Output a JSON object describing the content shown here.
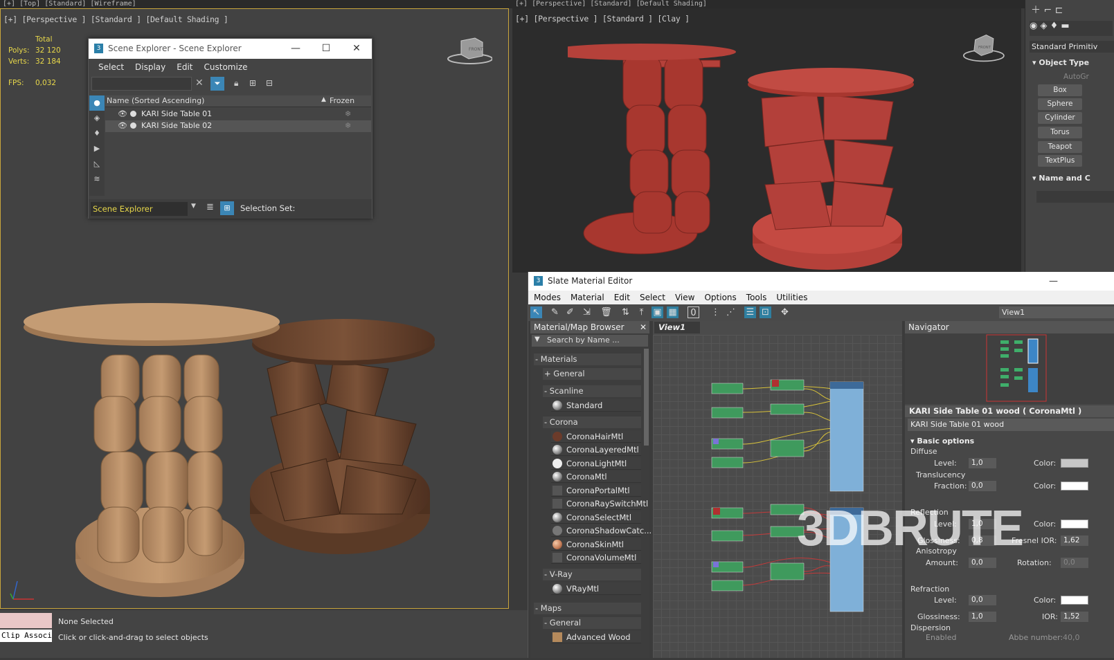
{
  "top_strip": {
    "left_text": "[+] [Top] [Standard] [Wireframe]",
    "right_text": "[+] [Perspective] [Standard] [Default Shading]"
  },
  "viewport_left": {
    "label": "[+] [Perspective ] [Standard ] [Default Shading ]",
    "stats": {
      "total_label": "Total",
      "polys_label": "Polys:",
      "polys_value": "32 120",
      "verts_label": "Verts:",
      "verts_value": "32 184",
      "fps_label": "FPS:",
      "fps_value": "0,032"
    },
    "viewcube_label": "FRONT"
  },
  "viewport_right": {
    "label": "[+] [Perspective ] [Standard ] [Clay ]",
    "viewcube_label": "FRONT"
  },
  "command_panel": {
    "dropdown": "Standard Primitiv",
    "section_object_type": "Object Type",
    "autogrid": "AutoGr",
    "buttons": [
      "Box",
      "Sphere",
      "Cylinder",
      "Torus",
      "Teapot",
      "TextPlus"
    ],
    "section_name": "Name and C"
  },
  "scene_explorer": {
    "title": "Scene Explorer - Scene Explorer",
    "menu": [
      "Select",
      "Display",
      "Edit",
      "Customize"
    ],
    "columns": {
      "name": "Name (Sorted Ascending)",
      "frozen": "Frozen"
    },
    "rows": [
      {
        "name": "KARI Side Table 01"
      },
      {
        "name": "KARI Side Table 02"
      }
    ],
    "footer_dropdown": "Scene Explorer",
    "selection_set_label": "Selection Set:"
  },
  "slate": {
    "title": "Slate Material Editor",
    "menu": [
      "Modes",
      "Material",
      "Edit",
      "Select",
      "View",
      "Options",
      "Tools",
      "Utilities"
    ],
    "view_dropdown": "View1",
    "browser": {
      "header": "Material/Map Browser",
      "search_placeholder": "Search by Name ...",
      "materials_label": "- Materials",
      "general": "+ General",
      "scanline": "- Scanline",
      "standard": "Standard",
      "corona": "- Corona",
      "corona_items": [
        "CoronaHairMtl",
        "CoronaLayeredMtl",
        "CoronaLightMtl",
        "CoronaMtl",
        "CoronaPortalMtl",
        "CoronaRaySwitchMtl",
        "CoronaSelectMtl",
        "CoronaShadowCatc...",
        "CoronaSkinMtl",
        "CoronaVolumeMtl"
      ],
      "vray": "- V-Ray",
      "vray_item": "VRayMtl",
      "maps_label": "- Maps",
      "maps_general": "- General",
      "maps_first": "Advanced Wood"
    },
    "view_tab": "View1",
    "navigator": "Navigator",
    "props": {
      "header": "KARI Side Table 01 wood  ( CoronaMtl )",
      "name_field": "KARI Side Table 01 wood",
      "basic_options": "Basic options",
      "diffuse": "Diffuse",
      "level": "Level:",
      "diffuse_level": "1,0",
      "color": "Color:",
      "translucency": "Translucency",
      "fraction": "Fraction:",
      "fraction_value": "0,0",
      "reflection": "Reflection",
      "refl_level": "1,0",
      "glossiness": "Glossiness:",
      "refl_gloss": "0,8",
      "fresnel": "Fresnel IOR:",
      "fresnel_value": "1,62",
      "anisotropy": "Anisotropy",
      "amount": "Amount:",
      "amount_value": "0,0",
      "rotation": "Rotation:",
      "rotation_value": "0,0",
      "refraction": "Refraction",
      "refr_level": "0,0",
      "refr_gloss": "1,0",
      "ior": "IOR:",
      "ior_value": "1,52",
      "dispersion": "Dispersion",
      "enabled": "Enabled",
      "abbe": "Abbe number:",
      "abbe_value": "40,0"
    },
    "watermark": "3DBRUTE"
  },
  "status": {
    "clip_label": "Clip Associ",
    "none_selected": "None Selected",
    "hint": "Click or click-and-drag to select objects"
  },
  "colors": {
    "viewport_border": "#c9a53c",
    "stat_yellow": "#e8d84a",
    "clay_red": "#b5413a",
    "wood_light": "#b08560",
    "wood_dark": "#6a4530",
    "node_green": "#4fae6a"
  }
}
